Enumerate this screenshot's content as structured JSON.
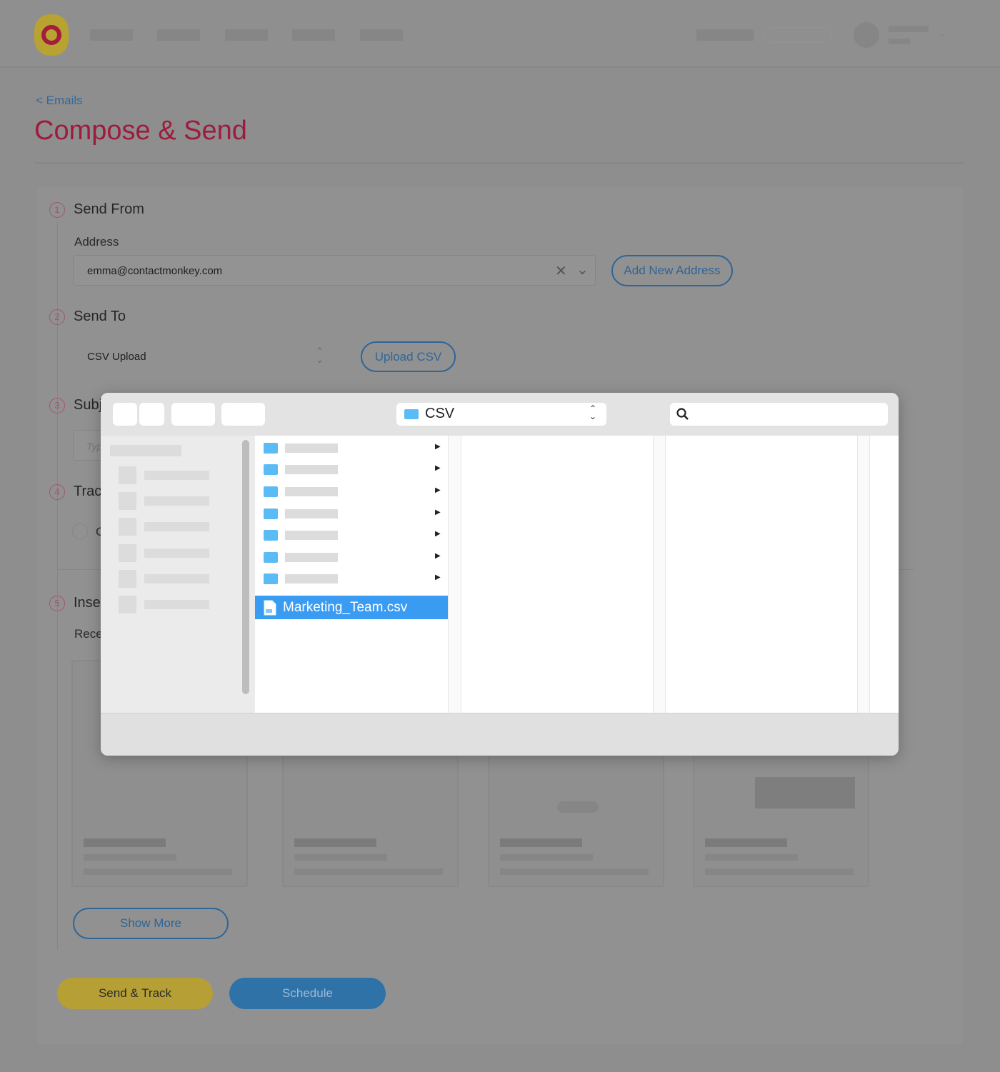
{
  "header": {
    "logo": "ContactMonkey"
  },
  "breadcrumb": "< Emails",
  "page_title": "Compose & Send",
  "steps": [
    {
      "num": "1",
      "title": "Send From"
    },
    {
      "num": "2",
      "title": "Send To"
    },
    {
      "num": "3",
      "title": "Subj"
    },
    {
      "num": "4",
      "title": "Trac"
    },
    {
      "num": "5",
      "title": "Inse"
    }
  ],
  "send_from": {
    "label": "Address",
    "value": "emma@contactmonkey.com",
    "add_button": "Add New Address"
  },
  "send_to": {
    "select_value": "CSV Upload",
    "upload_button": "Upload CSV"
  },
  "subject": {
    "placeholder": "Typ"
  },
  "tracking": {
    "option_partial": "C"
  },
  "insert": {
    "label_partial": "Rece"
  },
  "show_more": "Show More",
  "actions": {
    "send_track": "Send & Track",
    "schedule": "Schedule"
  },
  "file_dialog": {
    "location": "CSV",
    "search_placeholder": "",
    "selected_file": "Marketing_Team.csv",
    "folder_count": 7,
    "colors": {
      "selection": "#3a9bf2",
      "folder": "#5bbcf5"
    }
  }
}
